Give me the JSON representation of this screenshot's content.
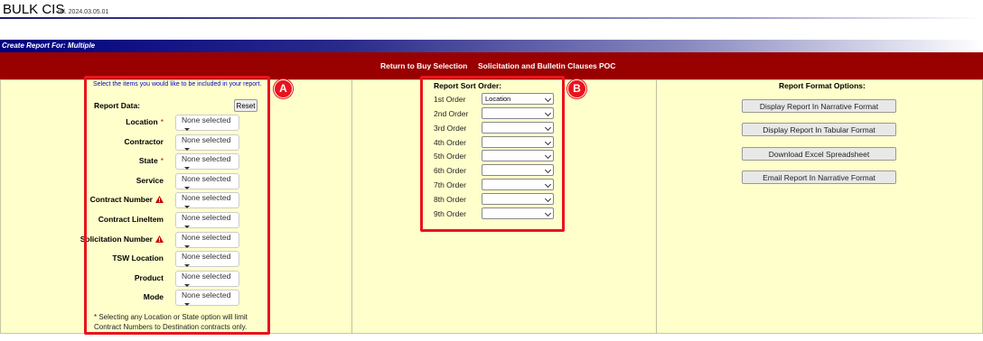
{
  "app": {
    "title": "BULK CIS",
    "release": "rel. 2024.03.05.01"
  },
  "title_bar": {
    "text": "Create Report For: Multiple"
  },
  "nav": {
    "items": [
      "Return to Buy Selection",
      "Solicitation and Bulletin Clauses",
      "POC"
    ]
  },
  "report_data": {
    "hint": "Select the items you would like to be included in your report.",
    "label": "Report Data:",
    "reset_label": "Reset",
    "fields": [
      {
        "label": "Location",
        "required": "*",
        "warning": false,
        "value": "None selected"
      },
      {
        "label": "Contractor",
        "required": "",
        "warning": false,
        "value": "None selected"
      },
      {
        "label": "State",
        "required": "*",
        "warning": false,
        "value": "None selected"
      },
      {
        "label": "Service",
        "required": "",
        "warning": false,
        "value": "None selected"
      },
      {
        "label": "Contract Number",
        "required": "",
        "warning": true,
        "value": "None selected"
      },
      {
        "label": "Contract LineItem",
        "required": "",
        "warning": false,
        "value": "None selected"
      },
      {
        "label": "Solicitation Number",
        "required": "",
        "warning": true,
        "value": "None selected"
      },
      {
        "label": "TSW Location",
        "required": "",
        "warning": false,
        "value": "None selected"
      },
      {
        "label": "Product",
        "required": "",
        "warning": false,
        "value": "None selected"
      },
      {
        "label": "Mode",
        "required": "",
        "warning": false,
        "value": "None selected"
      }
    ],
    "footnote": "* Selecting any Location or State option will limit Contract Numbers to Destination contracts only."
  },
  "sort_order": {
    "title": "Report Sort Order:",
    "rows": [
      {
        "label": "1st Order",
        "value": "Location"
      },
      {
        "label": "2nd Order",
        "value": ""
      },
      {
        "label": "3rd Order",
        "value": ""
      },
      {
        "label": "4th Order",
        "value": ""
      },
      {
        "label": "5th Order",
        "value": ""
      },
      {
        "label": "6th Order",
        "value": ""
      },
      {
        "label": "7th Order",
        "value": ""
      },
      {
        "label": "8th Order",
        "value": ""
      },
      {
        "label": "9th Order",
        "value": ""
      }
    ]
  },
  "format_options": {
    "title": "Report Format Options:",
    "buttons": [
      "Display Report In Narrative Format",
      "Display Report In Tabular Format",
      "Download Excel Spreadsheet",
      "Email Report In Narrative Format"
    ]
  },
  "callouts": {
    "a": "A",
    "b": "B"
  },
  "colors": {
    "nav_bg": "#990000",
    "panel_bg": "#ffffcc",
    "callout": "#e8141c",
    "title_bar": "#000080"
  }
}
